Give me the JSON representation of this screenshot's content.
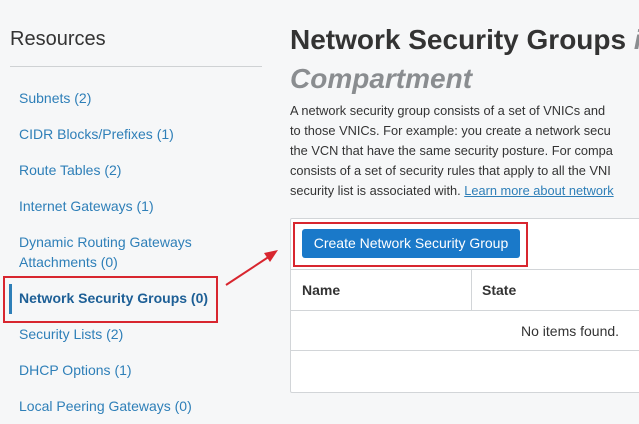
{
  "sidebar": {
    "title": "Resources",
    "items": [
      {
        "label": "Subnets (2)"
      },
      {
        "label": "CIDR Blocks/Prefixes (1)"
      },
      {
        "label": "Route Tables (2)"
      },
      {
        "label": "Internet Gateways (1)"
      },
      {
        "label_line1": "Dynamic Routing Gateways",
        "label_line2": "Attachments (0)"
      },
      {
        "label": "Network Security Groups (0)"
      },
      {
        "label": "Security Lists (2)"
      },
      {
        "label": "DHCP Options (1)"
      },
      {
        "label": "Local Peering Gateways (0)"
      }
    ]
  },
  "main": {
    "title": "Network Security Groups",
    "title_em": "in",
    "title_line2": "Compartment",
    "description_lines": [
      "A network security group consists of a set of VNICs and",
      "to those VNICs. For example: you create a network secu",
      "the VCN that have the same security posture. For compa",
      "consists of a set of security rules that apply to all the VNI",
      "security list is associated with. "
    ],
    "learn_more": "Learn more about network",
    "create_button": "Create Network Security Group",
    "table": {
      "columns": [
        "Name",
        "State"
      ],
      "empty_message": "No items found."
    }
  },
  "colors": {
    "link": "#2e7fb8",
    "primary_button": "#1a79c9",
    "highlight": "#d8262f"
  }
}
